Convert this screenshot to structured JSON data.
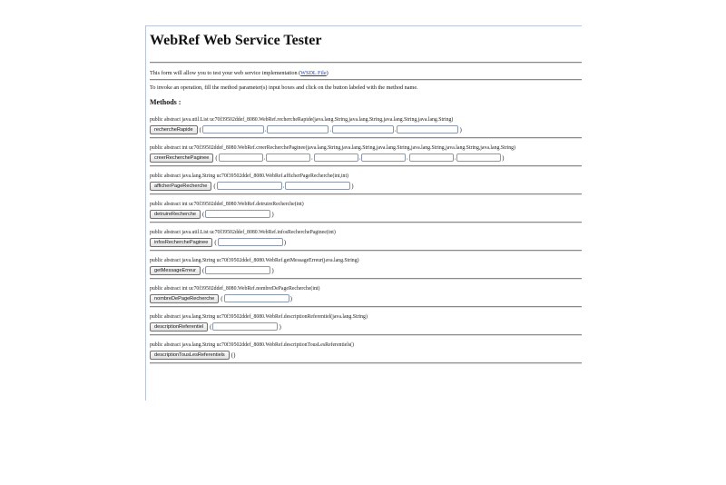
{
  "title": "WebRef Web Service Tester",
  "intro_text": "This form will allow you to test your web service implementation (",
  "wsdl_link": "WSDL File",
  "intro_close": ")",
  "instructions": "To invoke an operation, fill the method parameter(s) input boxes and click on the button labeled with the method name.",
  "methods_heading": "Methods :",
  "methods": [
    {
      "signature": "public abstract java.util.List uc70f39502ddef_8080.WebRef.rechercheRapide(java.lang.String,java.lang.String,java.lang.String,java.lang.String)",
      "button": "rechercheRapide",
      "open": "(",
      "close": ")",
      "params": 4
    },
    {
      "signature": "public abstract int uc70f39502ddef_8080.WebRef.creerRecherchePaginee(java.lang.String,java.lang.String,java.lang.String,java.lang.String,java.lang.String,java.lang.String)",
      "button": "creerRecherchePaginee",
      "open": "(",
      "close": ")",
      "params": 6
    },
    {
      "signature": "public abstract java.lang.String uc70f39502ddef_8080.WebRef.afficherPageRecherche(int,int)",
      "button": "afficherPageRecherche",
      "open": "(",
      "close": ")",
      "params": 2
    },
    {
      "signature": "public abstract int uc70f39502ddef_8080.WebRef.detruireRecherche(int)",
      "button": "detruireRecherche",
      "open": "(",
      "close": ")",
      "params": 1
    },
    {
      "signature": "public abstract java.util.List uc70f39502ddef_8080.WebRef.infosRecherchePaginee(int)",
      "button": "infosRecherchePaginee",
      "open": "(",
      "close": ")",
      "params": 1
    },
    {
      "signature": "public abstract java.lang.String uc70f39502ddef_8080.WebRef.getMessageErreur(java.lang.String)",
      "button": "getMessageErreur",
      "open": "(",
      "close": ")",
      "params": 1
    },
    {
      "signature": "public abstract int uc70f39502ddef_8080.WebRef.nombreDePageRecherche(int)",
      "button": "nombreDePageRecherche",
      "open": "(",
      "close": ")",
      "params": 1
    },
    {
      "signature": "public abstract java.lang.String uc70f39502ddef_8080.WebRef.descriptionReferentiel(java.lang.String)",
      "button": "descriptionReferentiel",
      "open": "(",
      "close": ")",
      "params": 1
    },
    {
      "signature": "public abstract java.lang.String uc70f39502ddef_8080.WebRef.descriptionTousLesReferentiels()",
      "button": "descriptionTousLesReferentiels",
      "open": "(",
      "close": ")",
      "params": 0
    }
  ]
}
